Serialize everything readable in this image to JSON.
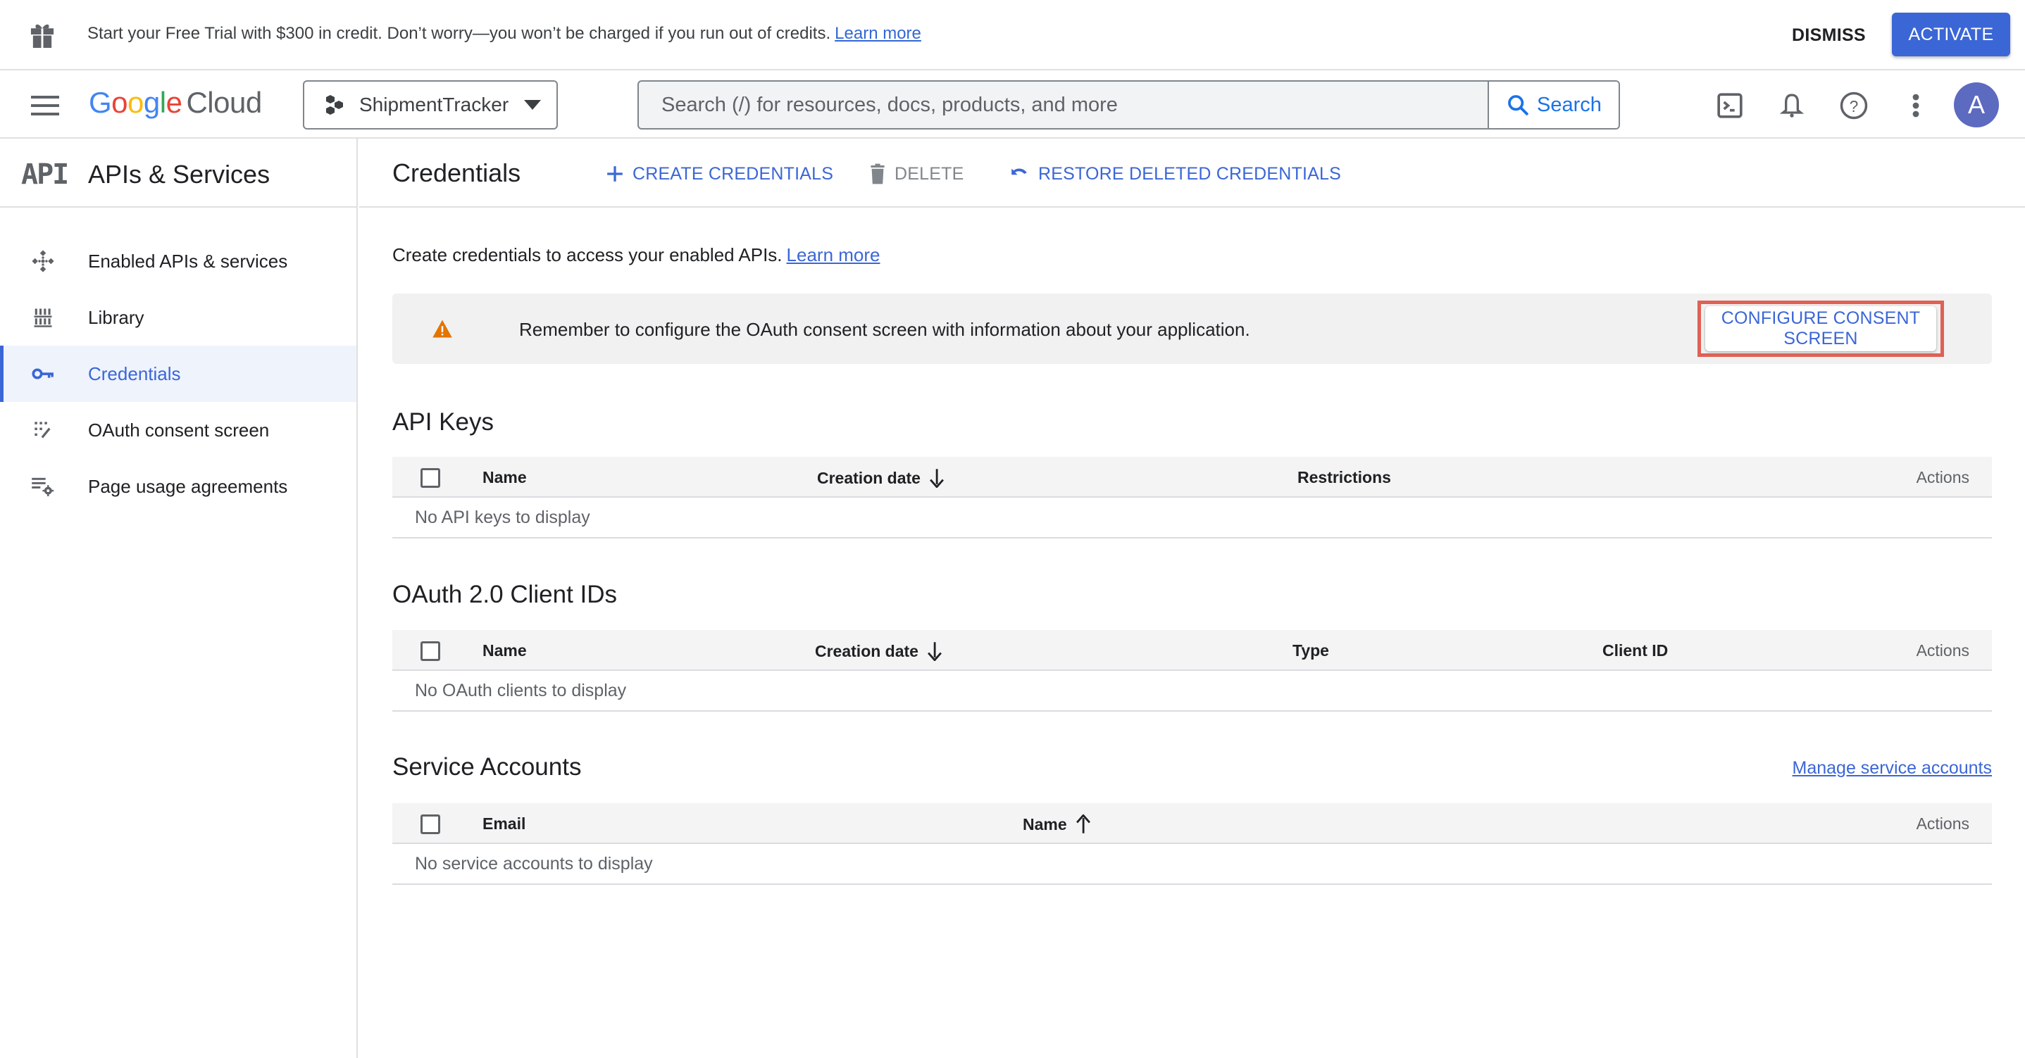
{
  "banner": {
    "message": "Start your Free Trial with $300 in credit. Don’t worry—you won’t be charged if you run out of credits.",
    "learn_more": "Learn more",
    "dismiss": "DISMISS",
    "activate": "ACTIVATE"
  },
  "header": {
    "logo_letters": [
      "G",
      "o",
      "o",
      "g",
      "l",
      "e"
    ],
    "logo_product": "Cloud",
    "project_name": "ShipmentTracker",
    "search_placeholder": "Search (/) for resources, docs, products, and more",
    "search_button": "Search",
    "avatar_initial": "A",
    "icons": [
      "cloud-shell-icon",
      "notifications-icon",
      "help-icon",
      "more-vert-icon"
    ]
  },
  "sidebar": {
    "logo": "API",
    "title": "APIs & Services",
    "items": [
      {
        "label": "Enabled APIs & services",
        "icon": "enabled-apis-icon",
        "active": false
      },
      {
        "label": "Library",
        "icon": "library-icon",
        "active": false
      },
      {
        "label": "Credentials",
        "icon": "key-icon",
        "active": true
      },
      {
        "label": "OAuth consent screen",
        "icon": "oauth-consent-icon",
        "active": false
      },
      {
        "label": "Page usage agreements",
        "icon": "page-settings-icon",
        "active": false
      }
    ]
  },
  "toolbar": {
    "title": "Credentials",
    "create": "CREATE CREDENTIALS",
    "delete": "DELETE",
    "restore": "RESTORE DELETED CREDENTIALS"
  },
  "main": {
    "intro": "Create credentials to access your enabled APIs.",
    "intro_link": "Learn more",
    "alert_text": "Remember to configure the OAuth consent screen with information about your application.",
    "alert_button": "CONFIGURE CONSENT SCREEN"
  },
  "api_keys": {
    "title": "API Keys",
    "columns": [
      "Name",
      "Creation date",
      "Restrictions",
      "Actions"
    ],
    "sort": {
      "column": "Creation date",
      "direction": "descending"
    },
    "empty": "No API keys to display"
  },
  "oauth_clients": {
    "title": "OAuth 2.0 Client IDs",
    "columns": [
      "Name",
      "Creation date",
      "Type",
      "Client ID",
      "Actions"
    ],
    "sort": {
      "column": "Creation date",
      "direction": "descending"
    },
    "empty": "No OAuth clients to display"
  },
  "service_accounts": {
    "title": "Service Accounts",
    "manage_link": "Manage service accounts",
    "columns": [
      "Email",
      "Name",
      "Actions"
    ],
    "sort": {
      "column": "Name",
      "direction": "ascending"
    },
    "empty": "No service accounts to display"
  },
  "colors": {
    "accent": "#3b66d6",
    "activate_bg": "#3b66d6",
    "warning": "#e37400",
    "highlight_box": "#e06055",
    "avatar_bg": "#5c6bc0"
  }
}
